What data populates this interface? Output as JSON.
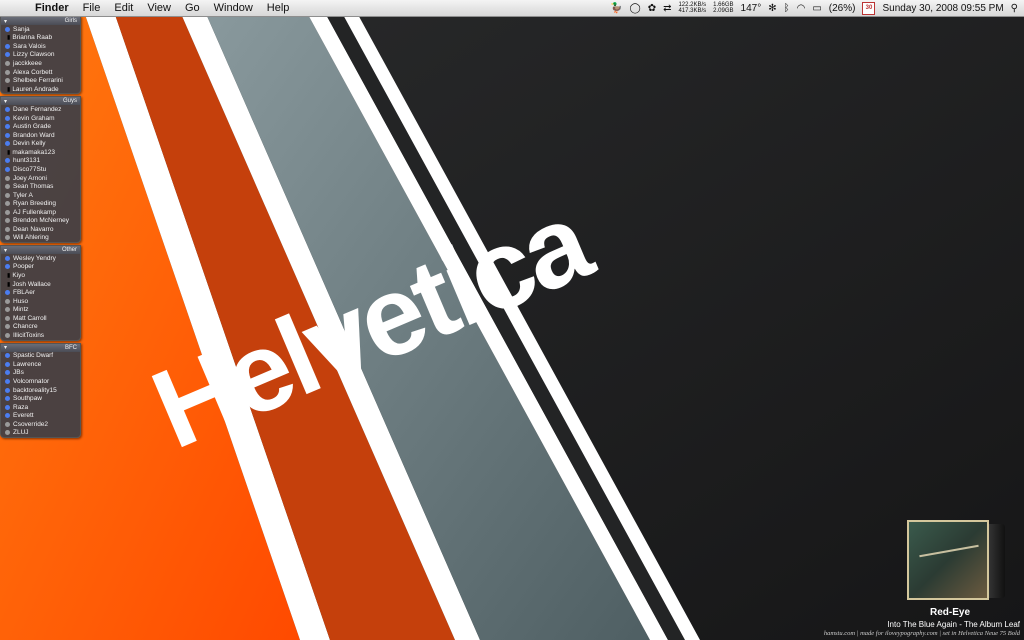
{
  "menubar": {
    "app": "Finder",
    "menus": [
      "File",
      "Edit",
      "View",
      "Go",
      "Window",
      "Help"
    ],
    "net_up": "122.2KB/s",
    "net_down": "417.3KB/s",
    "mem_used": "1.66GB",
    "mem_free": "2.09GB",
    "temp": "147°",
    "battery": "(26%)",
    "cal_day": "30",
    "datetime": "Sunday 30, 2008 09:55 PM"
  },
  "wallpaper": {
    "word": "Helvetica",
    "colors": {
      "orange": "#ff5a00",
      "rust": "#c43a0a",
      "slate": "#6f8286",
      "dark": "#202122"
    }
  },
  "buddylist": {
    "groups": [
      {
        "name": "Girls",
        "buddies": [
          {
            "name": "Sanja",
            "status": "available"
          },
          {
            "name": "Brianna Raab",
            "status": "mobile"
          },
          {
            "name": "Sara Valois",
            "status": "available"
          },
          {
            "name": "Lizzy Clawson",
            "status": "available"
          },
          {
            "name": "jacckkeee",
            "status": "idle"
          },
          {
            "name": "Alexa Corbett",
            "status": "idle"
          },
          {
            "name": "Shelbee Ferrarini",
            "status": "idle"
          },
          {
            "name": "Lauren Andrade",
            "status": "mobile"
          }
        ]
      },
      {
        "name": "Guys",
        "buddies": [
          {
            "name": "Dane Fernandez",
            "status": "available"
          },
          {
            "name": "Kevin Graham",
            "status": "available"
          },
          {
            "name": "Austin Grade",
            "status": "available"
          },
          {
            "name": "Brandon Ward",
            "status": "available"
          },
          {
            "name": "Devin Kelly",
            "status": "available"
          },
          {
            "name": "makamaka123",
            "status": "mobile"
          },
          {
            "name": "hunt3131",
            "status": "available"
          },
          {
            "name": "Disco77Stu",
            "status": "available"
          },
          {
            "name": "Joey Arnoni",
            "status": "idle"
          },
          {
            "name": "Sean Thomas",
            "status": "idle"
          },
          {
            "name": "Tyler A",
            "status": "idle"
          },
          {
            "name": "Ryan Breeding",
            "status": "idle"
          },
          {
            "name": "AJ Fullenkamp",
            "status": "idle"
          },
          {
            "name": "Brendon McNerney",
            "status": "idle"
          },
          {
            "name": "Dean Navarro",
            "status": "idle"
          },
          {
            "name": "Will Ahlering",
            "status": "idle"
          }
        ]
      },
      {
        "name": "Other",
        "buddies": [
          {
            "name": "Wesley Yendry",
            "status": "available"
          },
          {
            "name": "Pooper",
            "status": "available"
          },
          {
            "name": "Kiyo",
            "status": "mobile"
          },
          {
            "name": "Josh Wallace",
            "status": "mobile"
          },
          {
            "name": "FBLAer",
            "status": "available"
          },
          {
            "name": "Huso",
            "status": "idle"
          },
          {
            "name": "Mintz",
            "status": "idle"
          },
          {
            "name": "Matt Carroll",
            "status": "idle"
          },
          {
            "name": "Chancre",
            "status": "idle"
          },
          {
            "name": "IllicitToxins",
            "status": "idle"
          }
        ]
      },
      {
        "name": "BFC",
        "buddies": [
          {
            "name": "Spastic Dwarf",
            "status": "available"
          },
          {
            "name": "Lawrence",
            "status": "available"
          },
          {
            "name": "JBs",
            "status": "available"
          },
          {
            "name": "Volcomnator",
            "status": "available"
          },
          {
            "name": "backtoreality15",
            "status": "available"
          },
          {
            "name": "Southpaw",
            "status": "available"
          },
          {
            "name": "Raza",
            "status": "available"
          },
          {
            "name": "Everett",
            "status": "available"
          },
          {
            "name": "Csoverride2",
            "status": "idle"
          },
          {
            "name": "ZLUJ",
            "status": "idle"
          }
        ]
      }
    ]
  },
  "now_playing": {
    "track": "Red-Eye",
    "album_line": "Into The Blue Again - The Album Leaf"
  },
  "credits": "hamstu.com | made for iloveypography.com | set in Helvetica Neue 75 Bold"
}
